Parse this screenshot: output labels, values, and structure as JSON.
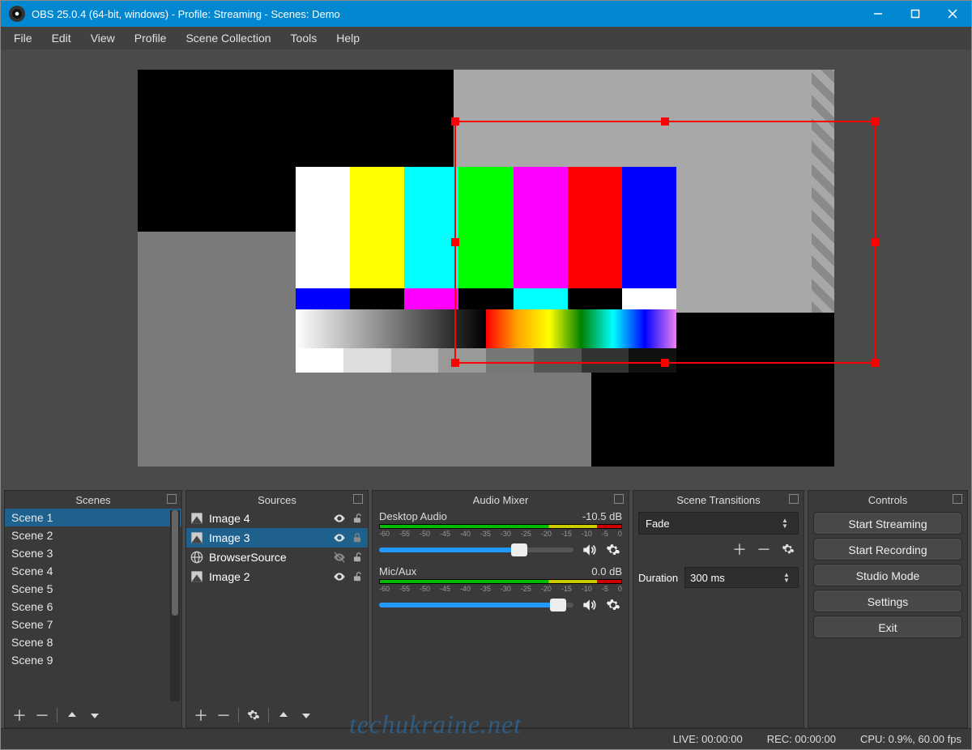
{
  "window": {
    "title": "OBS 25.0.4 (64-bit, windows) - Profile: Streaming - Scenes: Demo"
  },
  "menubar": [
    "File",
    "Edit",
    "View",
    "Profile",
    "Scene Collection",
    "Tools",
    "Help"
  ],
  "docks": {
    "scenes": {
      "title": "Scenes",
      "items": [
        "Scene 1",
        "Scene 2",
        "Scene 3",
        "Scene 4",
        "Scene 5",
        "Scene 6",
        "Scene 7",
        "Scene 8",
        "Scene 9"
      ]
    },
    "sources": {
      "title": "Sources",
      "items": [
        {
          "icon": "image-icon",
          "label": "Image 4",
          "visible": true,
          "locked": false,
          "selected": false
        },
        {
          "icon": "image-icon",
          "label": "Image 3",
          "visible": true,
          "locked": true,
          "selected": true
        },
        {
          "icon": "globe-icon",
          "label": "BrowserSource",
          "visible": false,
          "locked": false,
          "selected": false
        },
        {
          "icon": "image-icon",
          "label": "Image 2",
          "visible": true,
          "locked": false,
          "selected": false
        }
      ]
    },
    "mixer": {
      "title": "Audio Mixer",
      "ticks": [
        "-60",
        "-55",
        "-50",
        "-45",
        "-40",
        "-35",
        "-30",
        "-25",
        "-20",
        "-15",
        "-10",
        "-5",
        "0"
      ],
      "channels": [
        {
          "name": "Desktop Audio",
          "db": "-10.5 dB",
          "level": 72
        },
        {
          "name": "Mic/Aux",
          "db": "0.0 dB",
          "level": 92
        }
      ]
    },
    "transitions": {
      "title": "Scene Transitions",
      "current": "Fade",
      "duration_label": "Duration",
      "duration_value": "300 ms"
    },
    "controls": {
      "title": "Controls",
      "buttons": [
        "Start Streaming",
        "Start Recording",
        "Studio Mode",
        "Settings",
        "Exit"
      ]
    }
  },
  "statusbar": {
    "live": "LIVE: 00:00:00",
    "rec": "REC: 00:00:00",
    "cpu": "CPU: 0.9%, 60.00 fps"
  },
  "watermark": "techukraine.net",
  "preview": {
    "colorbars_row1": [
      "#ffffff",
      "#ffff00",
      "#00ffff",
      "#00ff00",
      "#ff00ff",
      "#ff0000",
      "#0000ff"
    ],
    "colorbars_row2": [
      "#0000ff",
      "#000000",
      "#ff00ff",
      "#000000",
      "#00ffff",
      "#000000",
      "#ffffff"
    ],
    "gray_steps": [
      "#ffffff",
      "#dddddd",
      "#bbbbbb",
      "#999999",
      "#777777",
      "#555555",
      "#333333",
      "#111111"
    ]
  }
}
